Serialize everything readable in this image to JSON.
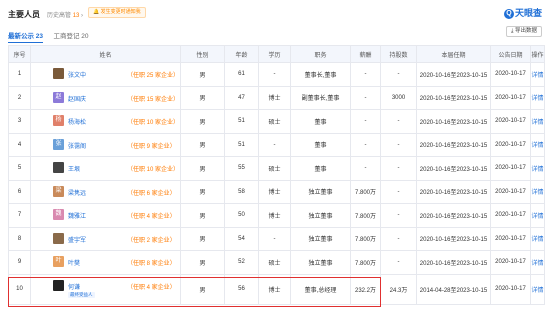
{
  "header": {
    "title": "主要人员",
    "history_label": "历史高管",
    "history_count": "13",
    "notice": "发生变更时通知我",
    "logo_text": "天眼查",
    "logo_mark": "Q",
    "tabs": [
      {
        "label": "最新公示 23"
      },
      {
        "label": "工商登记 20"
      }
    ],
    "export_label": "导出数据"
  },
  "table": {
    "headers": [
      "序号",
      "姓名",
      "性别",
      "年龄",
      "学历",
      "职务",
      "薪酬",
      "持股数",
      "本届任期",
      "公告日期",
      "操作"
    ],
    "rows": [
      {
        "idx": "1",
        "avatar": "",
        "avatar_color": "#7a5a3a",
        "name": "张文中",
        "tenure": "任职 25 家企业",
        "gender": "男",
        "age": "61",
        "edu": "-",
        "title": "董事长,董事",
        "pay": "-",
        "shares": "-",
        "term": "2020-10-16至2023-10-15",
        "date": "2020-10-17",
        "action": "详情"
      },
      {
        "idx": "2",
        "avatar": "赵",
        "avatar_color": "#8c7ad9",
        "name": "赵国庆",
        "tenure": "任职 15 家企业",
        "gender": "男",
        "age": "47",
        "edu": "博士",
        "title": "副董事长,董事",
        "pay": "-",
        "shares": "3000",
        "term": "2020-10-16至2023-10-15",
        "date": "2020-10-17",
        "action": "详情"
      },
      {
        "idx": "3",
        "avatar": "杨",
        "avatar_color": "#e0806a",
        "name": "杨海松",
        "tenure": "任职 10 家企业",
        "gender": "男",
        "age": "51",
        "edu": "硕士",
        "title": "董事",
        "pay": "-",
        "shares": "-",
        "term": "2020-10-16至2023-10-15",
        "date": "2020-10-17",
        "action": "详情"
      },
      {
        "idx": "4",
        "avatar": "张",
        "avatar_color": "#6aa0d9",
        "name": "张霭阁",
        "tenure": "任职 9 家企业",
        "gender": "男",
        "age": "51",
        "edu": "-",
        "title": "董事",
        "pay": "-",
        "shares": "-",
        "term": "2020-10-16至2023-10-15",
        "date": "2020-10-17",
        "action": "详情"
      },
      {
        "idx": "5",
        "avatar": "",
        "avatar_color": "#444444",
        "name": "王垠",
        "tenure": "任职 10 家企业",
        "gender": "男",
        "age": "55",
        "edu": "硕士",
        "title": "董事",
        "pay": "-",
        "shares": "-",
        "term": "2020-10-16至2023-10-15",
        "date": "2020-10-17",
        "action": "详情"
      },
      {
        "idx": "6",
        "avatar": "梁",
        "avatar_color": "#c98a5a",
        "name": "梁隽远",
        "tenure": "任职 6 家企业",
        "gender": "男",
        "age": "58",
        "edu": "博士",
        "title": "独立董事",
        "pay": "7.800万",
        "shares": "-",
        "term": "2020-10-16至2023-10-15",
        "date": "2020-10-17",
        "action": "详情"
      },
      {
        "idx": "7",
        "avatar": "魏",
        "avatar_color": "#d98ab0",
        "name": "魏雅江",
        "tenure": "任职 4 家企业",
        "gender": "男",
        "age": "50",
        "edu": "博士",
        "title": "独立董事",
        "pay": "7.800万",
        "shares": "-",
        "term": "2020-10-16至2023-10-15",
        "date": "2020-10-17",
        "action": "详情"
      },
      {
        "idx": "8",
        "avatar": "",
        "avatar_color": "#8a6a4a",
        "name": "盛宇军",
        "tenure": "任职 2 家企业",
        "gender": "男",
        "age": "54",
        "edu": "-",
        "title": "独立董事",
        "pay": "7.800万",
        "shares": "-",
        "term": "2020-10-16至2023-10-15",
        "date": "2020-10-17",
        "action": "详情"
      },
      {
        "idx": "9",
        "avatar": "叶",
        "avatar_color": "#e8a060",
        "name": "叶樊",
        "tenure": "任职 8 家企业",
        "gender": "男",
        "age": "52",
        "edu": "硕士",
        "title": "独立董事",
        "pay": "7.800万",
        "shares": "-",
        "term": "2020-10-16至2023-10-15",
        "date": "2020-10-17",
        "action": "详情"
      },
      {
        "idx": "10",
        "avatar": "",
        "avatar_color": "#222222",
        "name": "何谦",
        "tenure": "任职 4 家企业",
        "legal": "最终受益人",
        "gender": "男",
        "age": "56",
        "edu": "博士",
        "title": "董事,总经理",
        "pay": "232.2万",
        "shares": "24.3万",
        "term": "2014-04-28至2023-10-15",
        "date": "2020-10-17",
        "action": "详情"
      }
    ]
  }
}
